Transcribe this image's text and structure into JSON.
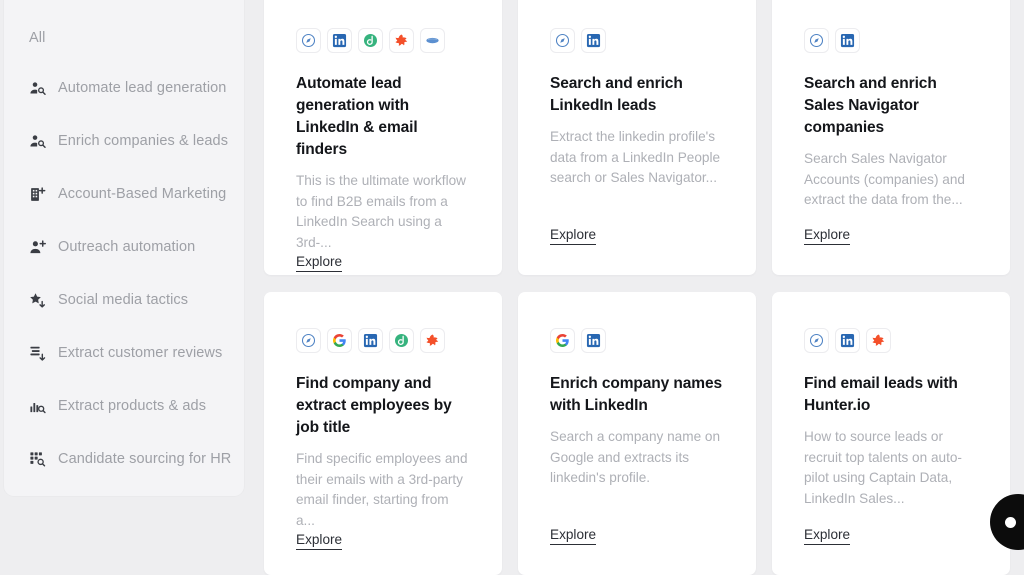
{
  "sidebar": {
    "items": [
      {
        "label": "All",
        "icon": "none"
      },
      {
        "label": "Automate lead generation",
        "icon": "person-search-icon"
      },
      {
        "label": "Enrich companies & leads",
        "icon": "person-search-icon"
      },
      {
        "label": "Account-Based Marketing",
        "icon": "building-plus-icon"
      },
      {
        "label": "Outreach automation",
        "icon": "person-plus-icon"
      },
      {
        "label": "Social media tactics",
        "icon": "star-download-icon"
      },
      {
        "label": "Extract customer reviews",
        "icon": "list-download-icon"
      },
      {
        "label": "Extract products & ads",
        "icon": "chart-search-icon"
      },
      {
        "label": "Candidate sourcing for HR",
        "icon": "grid-search-icon"
      }
    ]
  },
  "cards": [
    {
      "icons": [
        "compass-icon",
        "linkedin-icon",
        "dropcontact-icon",
        "hunter-icon",
        "lusha-icon"
      ],
      "title": "Automate lead generation with LinkedIn & email finders",
      "description": "This is the ultimate workflow to find B2B emails from a LinkedIn Search using a 3rd-...",
      "link_label": "Explore"
    },
    {
      "icons": [
        "compass-icon",
        "linkedin-icon"
      ],
      "title": "Search and enrich LinkedIn leads",
      "description": "Extract the linkedin profile's data from a LinkedIn People search or Sales Navigator...",
      "link_label": "Explore"
    },
    {
      "icons": [
        "compass-icon",
        "linkedin-icon"
      ],
      "title": "Search and enrich Sales Navigator companies",
      "description": "Search Sales Navigator Accounts (companies) and extract the data from the...",
      "link_label": "Explore"
    },
    {
      "icons": [
        "compass-icon",
        "google-icon",
        "linkedin-icon",
        "dropcontact-icon",
        "hunter-icon"
      ],
      "title": "Find company and extract employees by job title",
      "description": "Find specific employees and their emails with a 3rd-party email finder, starting from a...",
      "link_label": "Explore"
    },
    {
      "icons": [
        "google-icon",
        "linkedin-icon"
      ],
      "title": "Enrich company names with LinkedIn",
      "description": "Search a company name on Google and extracts its linkedin's profile.",
      "link_label": "Explore"
    },
    {
      "icons": [
        "compass-icon",
        "linkedin-icon",
        "hunter-icon"
      ],
      "title": "Find email leads with Hunter.io",
      "description": "How to source leads or recruit top talents on auto-pilot using Captain Data, LinkedIn Sales...",
      "link_label": "Explore"
    }
  ],
  "chat_widget": {
    "icon": "chat-bubble-icon"
  },
  "colors": {
    "page_background": "#eeeef0",
    "sidebar_background": "#f4f4f6",
    "card_background": "#ffffff",
    "title_text": "#14161a",
    "muted_text": "#aeb0b6",
    "nav_text": "#9ea0a6",
    "linkedin_blue": "#2867b2",
    "google_blue": "#4285f4",
    "dropcontact_green": "#36b37e",
    "hunter_orange": "#f4502a",
    "lusha_blue": "#5b8fd0",
    "chat_bubble": "#0c0c0c"
  }
}
